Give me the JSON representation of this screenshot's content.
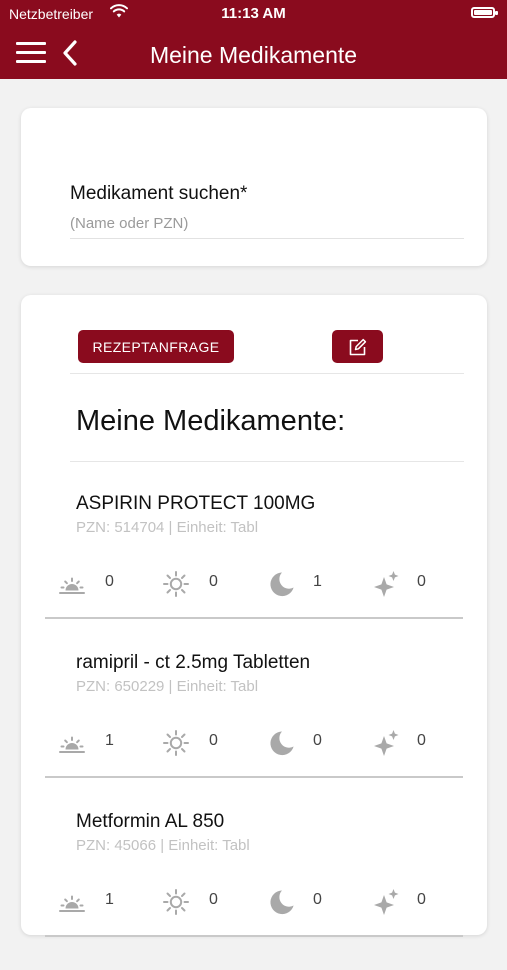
{
  "status_bar": {
    "carrier": "Netzbetreiber",
    "time": "11:13 AM"
  },
  "header": {
    "title": "Meine Medikamente"
  },
  "search": {
    "label": "Medikament suchen*",
    "placeholder": "(Name oder PZN)"
  },
  "list": {
    "rx_button_label": "REZEPTANFRAGE",
    "section_title": "Meine Medikamente:",
    "medications": [
      {
        "name": "ASPIRIN PROTECT 100MG",
        "meta": "PZN: 514704 | Einheit: Tabl",
        "doses": {
          "morning": "0",
          "noon": "0",
          "evening": "1",
          "night": "0"
        }
      },
      {
        "name": "ramipril - ct 2.5mg Tabletten",
        "meta": "PZN: 650229 | Einheit: Tabl",
        "doses": {
          "morning": "1",
          "noon": "0",
          "evening": "0",
          "night": "0"
        }
      },
      {
        "name": "Metformin AL 850",
        "meta": "PZN: 45066 | Einheit: Tabl",
        "doses": {
          "morning": "1",
          "noon": "0",
          "evening": "0",
          "night": "0"
        }
      }
    ]
  },
  "icons": {
    "menu": "hamburger-icon",
    "back": "chevron-left-icon",
    "edit": "edit-note-icon",
    "morning": "sunrise-icon",
    "noon": "sun-icon",
    "evening": "moon-icon",
    "night": "sparkles-icon"
  },
  "colors": {
    "brand": "#8a0b1e",
    "icon_gray": "#a9a9a9",
    "meta_gray": "#c2c2c2"
  }
}
